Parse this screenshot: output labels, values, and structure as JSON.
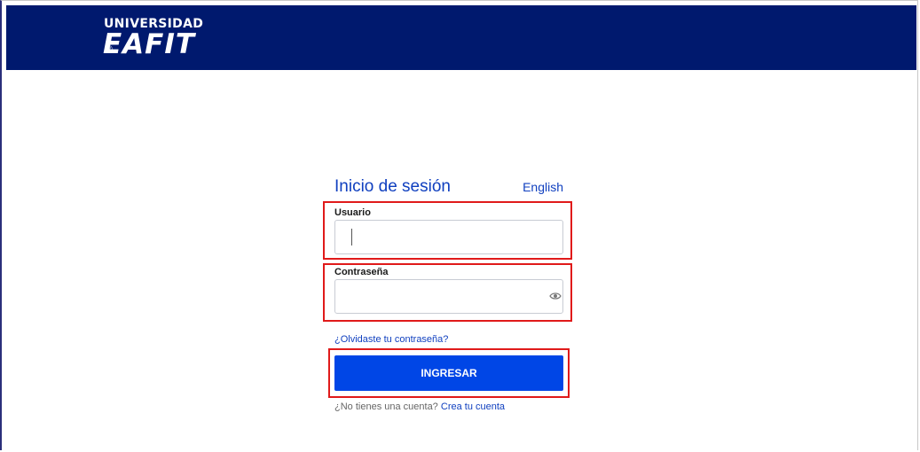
{
  "brand": {
    "logo_top": "UNIVERSIDAD",
    "logo_main": "EAFIT",
    "logo_reg": "®",
    "header_color": "#00196e"
  },
  "login": {
    "title": "Inicio de sesión",
    "language_link": "English",
    "username_label": "Usuario",
    "username_value": "",
    "password_label": "Contraseña",
    "password_value": "",
    "password_toggle_icon": "eye-icon",
    "forgot_link": "¿Olvidaste tu contraseña?",
    "submit_label": "INGRESAR",
    "signup_prompt": "¿No tienes una cuenta?",
    "signup_link": "Crea tu cuenta",
    "accent_color": "#0046e6",
    "highlight_color": "#e01a1a"
  }
}
